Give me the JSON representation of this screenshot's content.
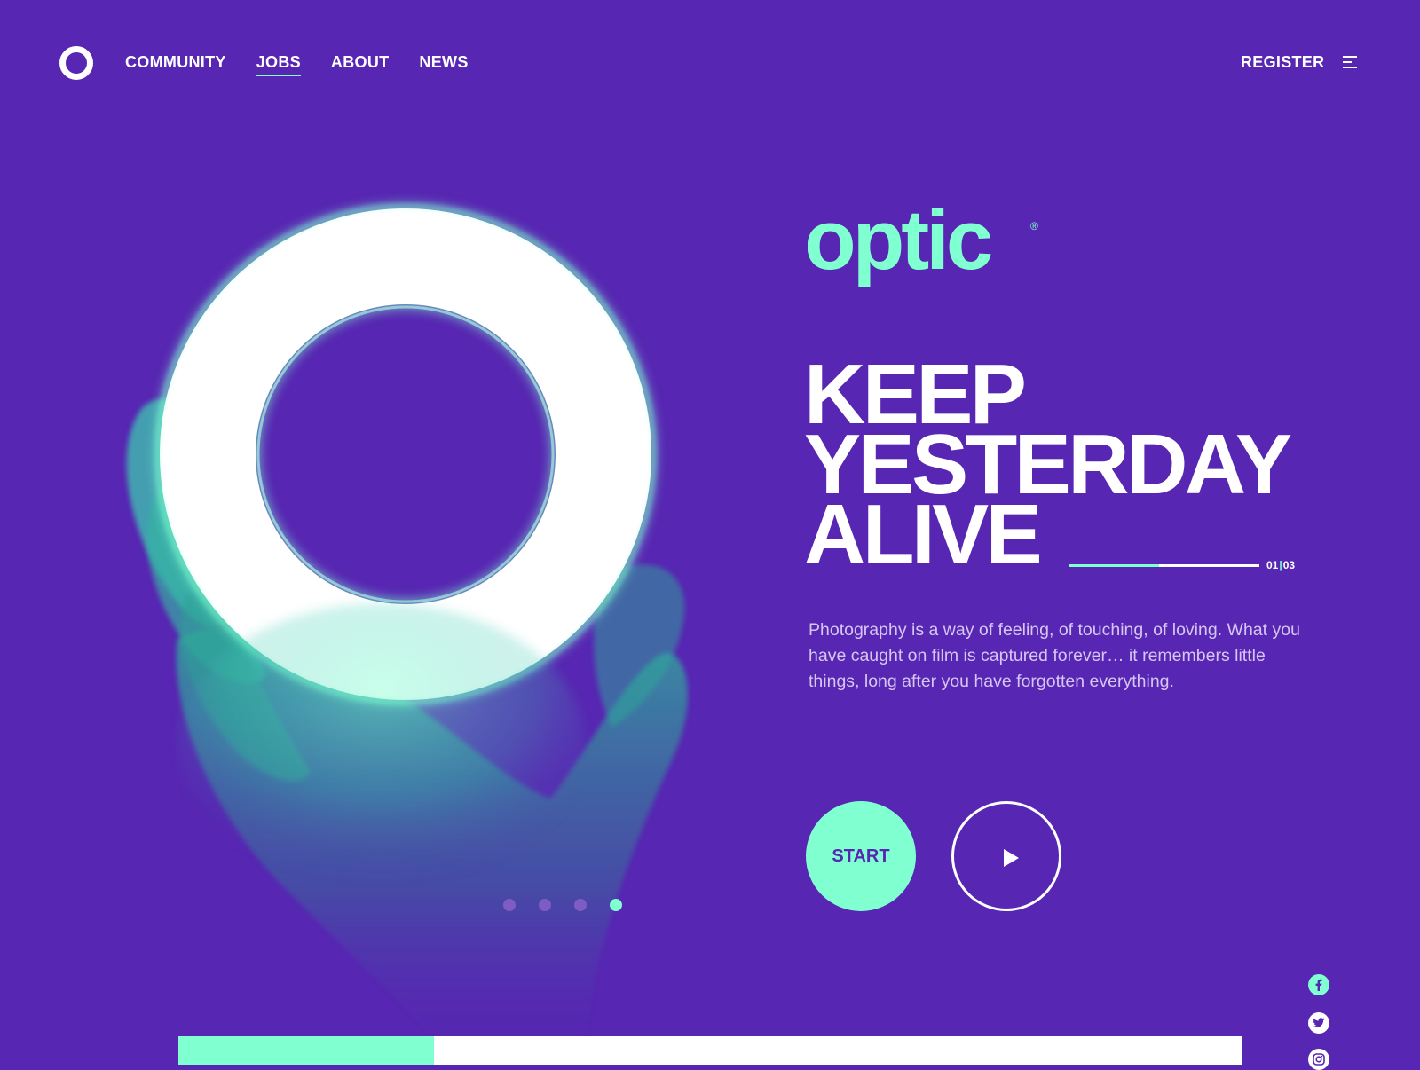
{
  "colors": {
    "background": "#5726b2",
    "accent": "#80ffd0",
    "text": "#ffffff",
    "muted_text": "#d7c6f3",
    "inactive_dot": "#7f5cc3"
  },
  "header": {
    "logo_icon": "ring-logo-icon",
    "nav": [
      {
        "label": "COMMUNITY",
        "active": false
      },
      {
        "label": "JOBS",
        "active": true
      },
      {
        "label": "ABOUT",
        "active": false
      },
      {
        "label": "NEWS",
        "active": false
      }
    ],
    "register_label": "REGISTER",
    "menu_icon": "hamburger-menu-icon"
  },
  "hero": {
    "image_description_icon": "hand-holding-glowing-ring-image"
  },
  "brand": {
    "name": "optic",
    "registered_mark": "®"
  },
  "headline": {
    "lines": [
      "KEEP",
      "YESTERDAY",
      "ALIVE"
    ]
  },
  "slide": {
    "current": "01",
    "separator": "|",
    "total": "03",
    "progress": 0.47
  },
  "description": "Photography is a way of feeling, of touching, of loving. What you have caught on film is captured forever… it remembers little things, long after you have forgotten everything.",
  "actions": {
    "start_label": "START",
    "play_icon": "play-icon"
  },
  "pagination": {
    "count": 4,
    "active_index": 3
  },
  "social": [
    {
      "name": "facebook-icon"
    },
    {
      "name": "twitter-icon"
    },
    {
      "name": "instagram-icon"
    }
  ],
  "bottom_bar": {
    "progress": 0.24
  }
}
